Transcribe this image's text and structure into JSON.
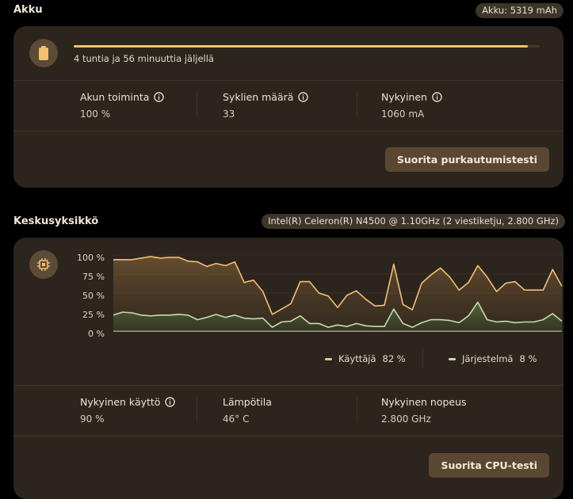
{
  "battery": {
    "title": "Akku",
    "capacity_chip": "Akku: 5319 mAh",
    "charge_fraction": 0.975,
    "remaining_text": "4 tuntia ja 56 minuuttia jäljellä",
    "stats": [
      {
        "label": "Akun toiminta",
        "value": "100 %"
      },
      {
        "label": "Syklien määrä",
        "value": "33"
      },
      {
        "label": "Nykyinen",
        "value": "1060 mA"
      }
    ],
    "button_label": "Suorita purkautumistesti"
  },
  "cpu": {
    "title": "Keskusyksikkö",
    "model_chip": "Intel(R) Celeron(R) N4500 @ 1.10GHz (2 viestiketju, 2.800 GHz)",
    "y_ticks": [
      "100 %",
      "75 %",
      "50 %",
      "25 %",
      "0 %"
    ],
    "legend": [
      {
        "label": "Käyttäjä",
        "value": "82 %",
        "color": "#f3c072"
      },
      {
        "label": "Järjestelmä",
        "value": "8 %",
        "color": "#c5dbb0"
      }
    ],
    "stats": [
      {
        "label": "Nykyinen käyttö",
        "value": "90 %",
        "info": true
      },
      {
        "label": "Lämpötila",
        "value": "46° C",
        "info": false
      },
      {
        "label": "Nykyinen nopeus",
        "value": "2.800 GHz",
        "info": false
      }
    ],
    "button_label": "Suorita CPU-testi"
  },
  "chart_data": {
    "type": "area",
    "ylim": [
      0,
      100
    ],
    "series": [
      {
        "name": "Käyttäjä",
        "values": [
          94,
          94,
          94,
          96,
          98,
          96,
          97,
          97,
          92,
          91,
          85,
          89,
          86,
          91,
          64,
          67,
          52,
          22,
          29,
          36,
          65,
          65,
          50,
          46,
          31,
          47,
          53,
          42,
          33,
          34,
          88,
          35,
          28,
          63,
          74,
          83,
          71,
          54,
          64,
          86,
          71,
          52,
          63,
          65,
          54,
          54,
          54,
          81,
          59
        ]
      },
      {
        "name": "Järjestelmä",
        "values": [
          21,
          25,
          24,
          21,
          20,
          21,
          21,
          22,
          21,
          15,
          18,
          22,
          18,
          21,
          17,
          16,
          17,
          5,
          12,
          13,
          20,
          10,
          10,
          5,
          8,
          6,
          10,
          7,
          6,
          6,
          29,
          10,
          5,
          11,
          15,
          15,
          14,
          11,
          20,
          38,
          15,
          12,
          13,
          11,
          12,
          12,
          15,
          23,
          13
        ]
      }
    ]
  }
}
